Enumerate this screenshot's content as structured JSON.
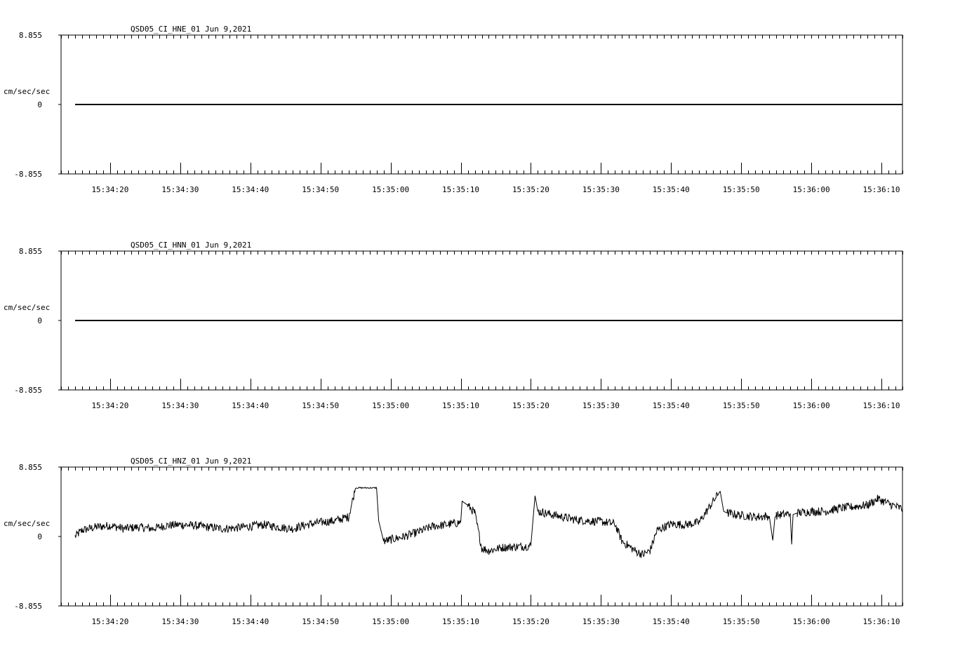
{
  "chart_data": [
    {
      "type": "line",
      "title": "QSD05_CI_HNE_01  Jun 9,2021",
      "ylabel": "cm/sec/sec",
      "ylim": [
        -8.855,
        8.855
      ],
      "ytick_labels": [
        "8.855",
        "0",
        "-8.855"
      ],
      "xlim": [
        "15:34:13",
        "15:36:13"
      ],
      "xtick_labels": [
        "15:34:20",
        "15:34:30",
        "15:34:40",
        "15:34:50",
        "15:35:00",
        "15:35:10",
        "15:35:20",
        "15:35:30",
        "15:35:40",
        "15:35:50",
        "15:36:00",
        "15:36:10"
      ],
      "grid": false,
      "series": [
        {
          "x": [
            "15:34:15",
            "15:36:13"
          ],
          "y": [
            0,
            0
          ]
        }
      ]
    },
    {
      "type": "line",
      "title": "QSD05_CI_HNN_01  Jun 9,2021",
      "ylabel": "cm/sec/sec",
      "ylim": [
        -8.855,
        8.855
      ],
      "ytick_labels": [
        "8.855",
        "0",
        "-8.855"
      ],
      "xlim": [
        "15:34:13",
        "15:36:13"
      ],
      "xtick_labels": [
        "15:34:20",
        "15:34:30",
        "15:34:40",
        "15:34:50",
        "15:35:00",
        "15:35:10",
        "15:35:20",
        "15:35:30",
        "15:35:40",
        "15:35:50",
        "15:36:00",
        "15:36:10"
      ],
      "grid": false,
      "series": [
        {
          "x": [
            "15:34:15",
            "15:36:13"
          ],
          "y": [
            0,
            0
          ]
        }
      ]
    },
    {
      "type": "line",
      "title": "QSD05_CI_HNZ_01  Jun 9,2021",
      "ylabel": "cm/sec/sec",
      "ylim": [
        -8.855,
        8.855
      ],
      "ytick_labels": [
        "8.855",
        "0",
        "-8.855"
      ],
      "xlim": [
        "15:34:13",
        "15:36:13"
      ],
      "xtick_labels": [
        "15:34:20",
        "15:34:30",
        "15:34:40",
        "15:34:50",
        "15:35:00",
        "15:35:10",
        "15:35:20",
        "15:35:30",
        "15:35:40",
        "15:35:50",
        "15:36:00",
        "15:36:10"
      ],
      "grid": false,
      "series": [
        {
          "x": [
            "15:34:15",
            "15:34:16",
            "15:34:18",
            "15:34:20",
            "15:34:22",
            "15:34:24",
            "15:34:26",
            "15:34:28",
            "15:34:30",
            "15:34:32",
            "15:34:34",
            "15:34:36",
            "15:34:38",
            "15:34:40",
            "15:34:42",
            "15:34:44",
            "15:34:46",
            "15:34:48",
            "15:34:50",
            "15:34:52",
            "15:34:54",
            "15:34:55",
            "15:34:58",
            "15:34:58.3",
            "15:34:59",
            "15:35:00",
            "15:35:02",
            "15:35:04",
            "15:35:06",
            "15:35:08",
            "15:35:10",
            "15:35:10.2",
            "15:35:11",
            "15:35:12",
            "15:35:13",
            "15:35:14",
            "15:35:16",
            "15:35:18",
            "15:35:20",
            "15:35:20.6",
            "15:35:21",
            "15:35:22",
            "15:35:24",
            "15:35:26",
            "15:35:28",
            "15:35:30",
            "15:35:32",
            "15:35:33",
            "15:35:35",
            "15:35:36",
            "15:35:37",
            "15:35:38",
            "15:35:40",
            "15:35:42",
            "15:35:44",
            "15:35:47",
            "15:35:47.5",
            "15:35:48",
            "15:35:50",
            "15:35:52",
            "15:35:54",
            "15:35:54.5",
            "15:35:54.8",
            "15:35:55",
            "15:35:57",
            "15:35:57.2",
            "15:35:57.4",
            "15:35:58",
            "15:36:00",
            "15:36:02",
            "15:36:04",
            "15:36:06",
            "15:36:08",
            "15:36:09.5",
            "15:36:11",
            "15:36:13"
          ],
          "y": [
            0.0,
            0.8,
            1.2,
            1.4,
            1.0,
            1.2,
            1.0,
            1.4,
            1.5,
            1.4,
            1.2,
            1.0,
            1.1,
            1.3,
            1.5,
            1.2,
            1.0,
            1.5,
            1.8,
            2.0,
            2.5,
            6.2,
            6.2,
            2.0,
            -0.6,
            -0.4,
            0.0,
            0.6,
            1.3,
            1.5,
            1.8,
            4.5,
            4.0,
            3.0,
            -1.5,
            -1.8,
            -1.4,
            -1.3,
            -1.2,
            5.2,
            3.2,
            3.0,
            2.6,
            2.2,
            2.0,
            1.9,
            1.6,
            -0.6,
            -1.9,
            -2.3,
            -1.8,
            0.8,
            1.6,
            1.5,
            1.8,
            5.8,
            3.2,
            3.0,
            2.7,
            2.5,
            2.6,
            -0.5,
            2.4,
            2.7,
            2.9,
            -1.0,
            2.8,
            3.0,
            3.2,
            3.2,
            3.6,
            3.8,
            4.0,
            4.8,
            4.2,
            3.5
          ]
        }
      ]
    }
  ]
}
